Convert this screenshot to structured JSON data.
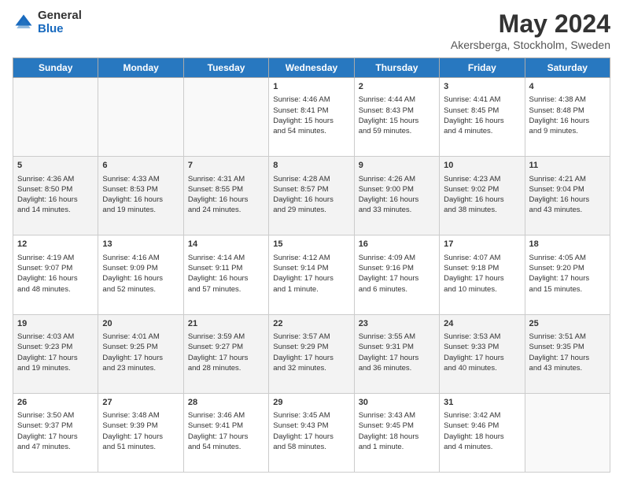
{
  "header": {
    "logo_general": "General",
    "logo_blue": "Blue",
    "title": "May 2024",
    "subtitle": "Akersberga, Stockholm, Sweden"
  },
  "days_of_week": [
    "Sunday",
    "Monday",
    "Tuesday",
    "Wednesday",
    "Thursday",
    "Friday",
    "Saturday"
  ],
  "weeks": [
    [
      {
        "day": "",
        "info": ""
      },
      {
        "day": "",
        "info": ""
      },
      {
        "day": "",
        "info": ""
      },
      {
        "day": "1",
        "info": "Sunrise: 4:46 AM\nSunset: 8:41 PM\nDaylight: 15 hours\nand 54 minutes."
      },
      {
        "day": "2",
        "info": "Sunrise: 4:44 AM\nSunset: 8:43 PM\nDaylight: 15 hours\nand 59 minutes."
      },
      {
        "day": "3",
        "info": "Sunrise: 4:41 AM\nSunset: 8:45 PM\nDaylight: 16 hours\nand 4 minutes."
      },
      {
        "day": "4",
        "info": "Sunrise: 4:38 AM\nSunset: 8:48 PM\nDaylight: 16 hours\nand 9 minutes."
      }
    ],
    [
      {
        "day": "5",
        "info": "Sunrise: 4:36 AM\nSunset: 8:50 PM\nDaylight: 16 hours\nand 14 minutes."
      },
      {
        "day": "6",
        "info": "Sunrise: 4:33 AM\nSunset: 8:53 PM\nDaylight: 16 hours\nand 19 minutes."
      },
      {
        "day": "7",
        "info": "Sunrise: 4:31 AM\nSunset: 8:55 PM\nDaylight: 16 hours\nand 24 minutes."
      },
      {
        "day": "8",
        "info": "Sunrise: 4:28 AM\nSunset: 8:57 PM\nDaylight: 16 hours\nand 29 minutes."
      },
      {
        "day": "9",
        "info": "Sunrise: 4:26 AM\nSunset: 9:00 PM\nDaylight: 16 hours\nand 33 minutes."
      },
      {
        "day": "10",
        "info": "Sunrise: 4:23 AM\nSunset: 9:02 PM\nDaylight: 16 hours\nand 38 minutes."
      },
      {
        "day": "11",
        "info": "Sunrise: 4:21 AM\nSunset: 9:04 PM\nDaylight: 16 hours\nand 43 minutes."
      }
    ],
    [
      {
        "day": "12",
        "info": "Sunrise: 4:19 AM\nSunset: 9:07 PM\nDaylight: 16 hours\nand 48 minutes."
      },
      {
        "day": "13",
        "info": "Sunrise: 4:16 AM\nSunset: 9:09 PM\nDaylight: 16 hours\nand 52 minutes."
      },
      {
        "day": "14",
        "info": "Sunrise: 4:14 AM\nSunset: 9:11 PM\nDaylight: 16 hours\nand 57 minutes."
      },
      {
        "day": "15",
        "info": "Sunrise: 4:12 AM\nSunset: 9:14 PM\nDaylight: 17 hours\nand 1 minute."
      },
      {
        "day": "16",
        "info": "Sunrise: 4:09 AM\nSunset: 9:16 PM\nDaylight: 17 hours\nand 6 minutes."
      },
      {
        "day": "17",
        "info": "Sunrise: 4:07 AM\nSunset: 9:18 PM\nDaylight: 17 hours\nand 10 minutes."
      },
      {
        "day": "18",
        "info": "Sunrise: 4:05 AM\nSunset: 9:20 PM\nDaylight: 17 hours\nand 15 minutes."
      }
    ],
    [
      {
        "day": "19",
        "info": "Sunrise: 4:03 AM\nSunset: 9:23 PM\nDaylight: 17 hours\nand 19 minutes."
      },
      {
        "day": "20",
        "info": "Sunrise: 4:01 AM\nSunset: 9:25 PM\nDaylight: 17 hours\nand 23 minutes."
      },
      {
        "day": "21",
        "info": "Sunrise: 3:59 AM\nSunset: 9:27 PM\nDaylight: 17 hours\nand 28 minutes."
      },
      {
        "day": "22",
        "info": "Sunrise: 3:57 AM\nSunset: 9:29 PM\nDaylight: 17 hours\nand 32 minutes."
      },
      {
        "day": "23",
        "info": "Sunrise: 3:55 AM\nSunset: 9:31 PM\nDaylight: 17 hours\nand 36 minutes."
      },
      {
        "day": "24",
        "info": "Sunrise: 3:53 AM\nSunset: 9:33 PM\nDaylight: 17 hours\nand 40 minutes."
      },
      {
        "day": "25",
        "info": "Sunrise: 3:51 AM\nSunset: 9:35 PM\nDaylight: 17 hours\nand 43 minutes."
      }
    ],
    [
      {
        "day": "26",
        "info": "Sunrise: 3:50 AM\nSunset: 9:37 PM\nDaylight: 17 hours\nand 47 minutes."
      },
      {
        "day": "27",
        "info": "Sunrise: 3:48 AM\nSunset: 9:39 PM\nDaylight: 17 hours\nand 51 minutes."
      },
      {
        "day": "28",
        "info": "Sunrise: 3:46 AM\nSunset: 9:41 PM\nDaylight: 17 hours\nand 54 minutes."
      },
      {
        "day": "29",
        "info": "Sunrise: 3:45 AM\nSunset: 9:43 PM\nDaylight: 17 hours\nand 58 minutes."
      },
      {
        "day": "30",
        "info": "Sunrise: 3:43 AM\nSunset: 9:45 PM\nDaylight: 18 hours\nand 1 minute."
      },
      {
        "day": "31",
        "info": "Sunrise: 3:42 AM\nSunset: 9:46 PM\nDaylight: 18 hours\nand 4 minutes."
      },
      {
        "day": "",
        "info": ""
      }
    ]
  ]
}
